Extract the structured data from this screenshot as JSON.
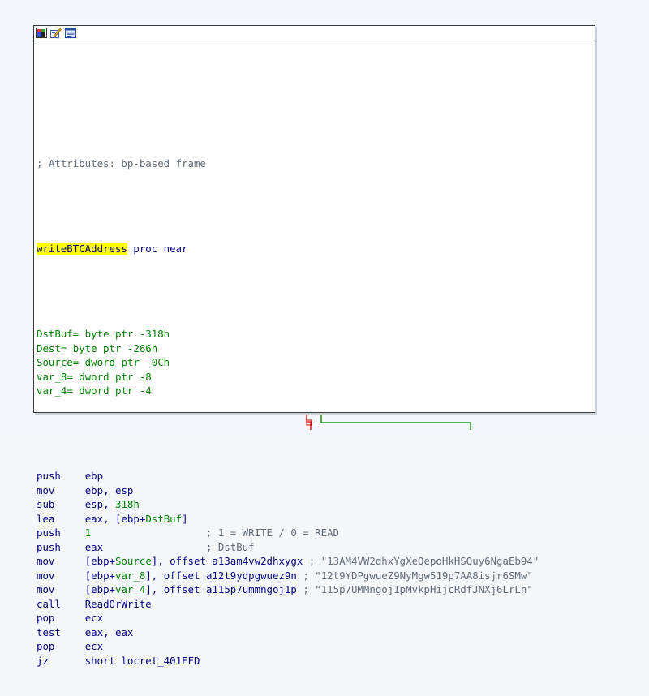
{
  "window": {
    "icons": [
      "graph-color-icon",
      "edit-node-icon",
      "group-node-icon"
    ]
  },
  "code": {
    "attributes_comment": "; Attributes: bp-based frame",
    "proc_name": "writeBTCAddress",
    "proc_rest": " proc near",
    "vars": [
      {
        "name": "DstBuf",
        "def": "= byte ptr -318h"
      },
      {
        "name": "Dest",
        "def": "= byte ptr -266h"
      },
      {
        "name": "Source",
        "def": "= dword ptr -0Ch"
      },
      {
        "name": "var_8",
        "def": "= dword ptr -8"
      },
      {
        "name": "var_4",
        "def": "= dword ptr -4"
      }
    ],
    "instructions": [
      {
        "mnem": "push",
        "ops": "ebp"
      },
      {
        "mnem": "mov",
        "ops": "ebp, esp"
      },
      {
        "mnem": "sub",
        "ops": "esp, 318h"
      },
      {
        "mnem": "lea",
        "ops": "eax, [ebp+DstBuf]"
      },
      {
        "mnem": "push",
        "ops": "1",
        "comment": "; 1 = WRITE / 0 = READ"
      },
      {
        "mnem": "push",
        "ops": "eax",
        "comment": "; DstBuf"
      },
      {
        "mnem": "mov",
        "ops": "[ebp+Source], offset a13am4vw2dhxygx",
        "comment": "; \"13AM4VW2dhxYgXeQepoHkHSQuy6NgaEb94\""
      },
      {
        "mnem": "mov",
        "ops": "[ebp+var_8], offset a12t9ydpgwuez9n",
        "comment": "; \"12t9YDPgwueZ9NyMgw519p7AA8isjr6SMw\""
      },
      {
        "mnem": "mov",
        "ops": "[ebp+var_4], offset a115p7ummngoj1p",
        "comment": "; \"115p7UMMngoj1pMvkpHijcRdfJNXj6LrLn\""
      },
      {
        "mnem": "call",
        "ops": "ReadOrWrite"
      },
      {
        "mnem": "pop",
        "ops": "ecx"
      },
      {
        "mnem": "test",
        "ops": "eax, eax"
      },
      {
        "mnem": "pop",
        "ops": "ecx"
      },
      {
        "mnem": "jz",
        "ops": "short locret_401EFD"
      }
    ]
  },
  "colors": {
    "highlight": "#ffff00",
    "keyword": "#00007f",
    "variable": "#008000",
    "comment": "#5f6b78",
    "edge_false": "#cc0000",
    "edge_true": "#008000"
  }
}
